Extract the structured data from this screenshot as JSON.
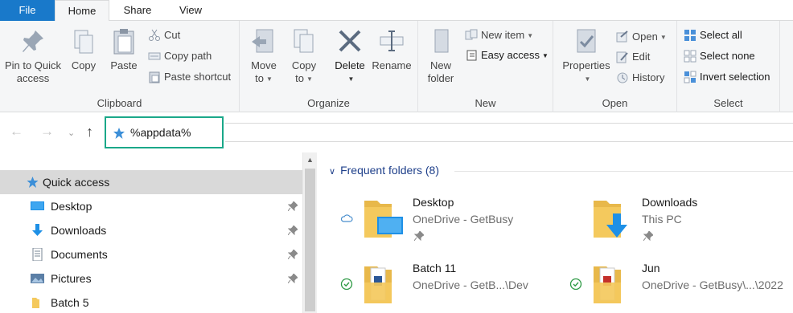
{
  "tabs": {
    "file": "File",
    "home": "Home",
    "share": "Share",
    "view": "View"
  },
  "ribbon": {
    "clipboard": {
      "label": "Clipboard",
      "pin_quick_access": [
        "Pin to Quick",
        "access"
      ],
      "copy": "Copy",
      "paste": "Paste",
      "cut": "Cut",
      "copy_path": "Copy path",
      "paste_shortcut": "Paste shortcut"
    },
    "organize": {
      "label": "Organize",
      "move_to": "Move",
      "move_to_2": "to",
      "copy_to": "Copy",
      "copy_to_2": "to",
      "delete": "Delete",
      "rename": "Rename"
    },
    "new": {
      "label": "New",
      "new_folder": "New",
      "new_folder_2": "folder",
      "new_item": "New item",
      "easy_access": "Easy access"
    },
    "open": {
      "label": "Open",
      "properties": "Properties",
      "open": "Open",
      "edit": "Edit",
      "history": "History"
    },
    "select": {
      "label": "Select",
      "select_all": "Select all",
      "select_none": "Select none",
      "invert_selection": "Invert selection"
    }
  },
  "address": {
    "value": "%appdata%"
  },
  "navpane": {
    "items": [
      {
        "label": "Quick access",
        "icon": "star-icon"
      },
      {
        "label": "Desktop",
        "icon": "desktop-icon"
      },
      {
        "label": "Downloads",
        "icon": "download-arrow-icon"
      },
      {
        "label": "Documents",
        "icon": "document-icon"
      },
      {
        "label": "Pictures",
        "icon": "pictures-icon"
      },
      {
        "label": "Batch 5",
        "icon": "folder-icon"
      }
    ]
  },
  "content": {
    "section_title": "Frequent folders (8)",
    "tiles": [
      {
        "name": "Desktop",
        "location": "OneDrive - GetBusy",
        "status": "cloud-icon"
      },
      {
        "name": "Downloads",
        "location": "This PC",
        "status": ""
      },
      {
        "name": "Batch 11",
        "location": "OneDrive - GetB...\\Dev",
        "status": "synced-check-icon"
      },
      {
        "name": "Jun",
        "location": "OneDrive - GetBusy\\...\\2022",
        "status": "synced-check-icon"
      }
    ]
  },
  "colors": {
    "file_tab": "#1979ca",
    "ribbon_bg": "#f5f6f7",
    "address_highlight": "#1aa889",
    "nav_selected": "#d9d9d9",
    "section_header": "#1e3f8a",
    "folder_yellow": "#f4c95d",
    "accent_blue": "#1e90e6"
  }
}
